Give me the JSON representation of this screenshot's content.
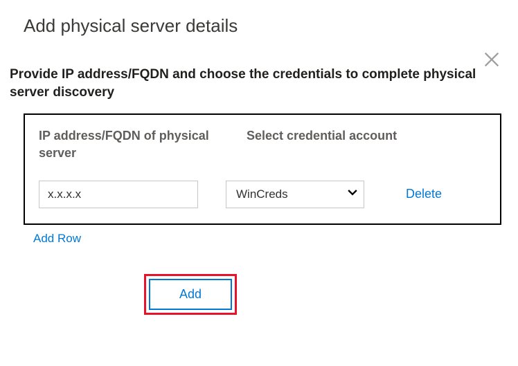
{
  "title": "Add physical server details",
  "description": "Provide IP address/FQDN and choose the credentials to complete physical server discovery",
  "table": {
    "headers": {
      "ip": "IP address/FQDN of physical server",
      "credential": "Select credential account"
    },
    "rows": [
      {
        "ip_value": "x.x.x.x",
        "credential_selected": "WinCreds",
        "delete_label": "Delete"
      }
    ]
  },
  "actions": {
    "add_row": "Add Row",
    "add": "Add"
  },
  "colors": {
    "link": "#0078d4",
    "highlight_border": "#e8132b"
  }
}
